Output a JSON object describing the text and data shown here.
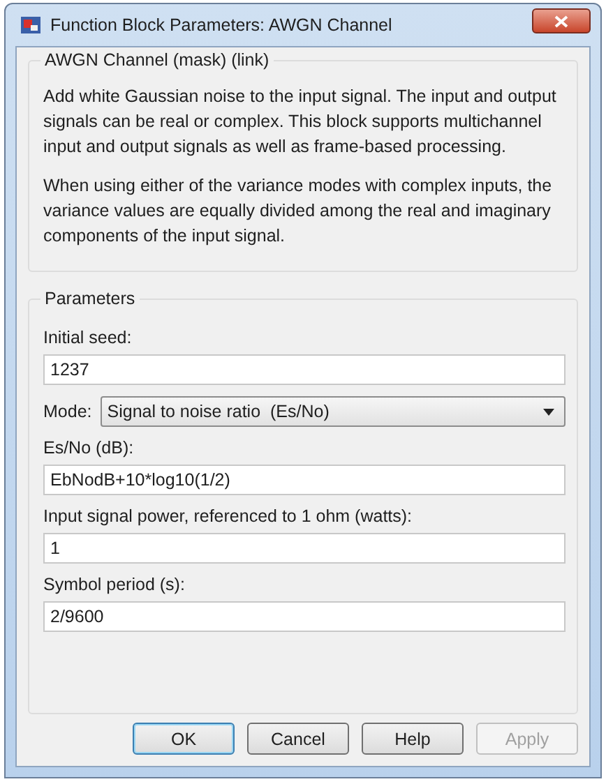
{
  "window": {
    "title": "Function Block Parameters: AWGN Channel"
  },
  "description": {
    "title": "AWGN Channel (mask) (link)",
    "paragraphs": [
      "Add white Gaussian noise to the input signal. The input and output signals can be real or complex. This block supports multichannel input and output signals as well as frame-based processing.",
      "When using either of the variance modes with complex inputs, the variance values are equally divided among the real and imaginary components of the input signal."
    ]
  },
  "parameters": {
    "title": "Parameters",
    "fields": [
      {
        "kind": "text",
        "label": "Initial seed:",
        "value": "1237"
      },
      {
        "kind": "dropdown",
        "label": "Mode:",
        "value": "Signal to noise ratio  (Es/No)"
      },
      {
        "kind": "text",
        "label": "Es/No (dB):",
        "value": "EbNodB+10*log10(1/2)"
      },
      {
        "kind": "text",
        "label": "Input signal power, referenced to 1 ohm (watts):",
        "value": "1"
      },
      {
        "kind": "text",
        "label": "Symbol period (s):",
        "value": "2/9600"
      }
    ]
  },
  "buttons": [
    {
      "label": "OK",
      "default": true,
      "disabled": false
    },
    {
      "label": "Cancel",
      "default": false,
      "disabled": false
    },
    {
      "label": "Help",
      "default": false,
      "disabled": false
    },
    {
      "label": "Apply",
      "default": false,
      "disabled": true
    }
  ]
}
